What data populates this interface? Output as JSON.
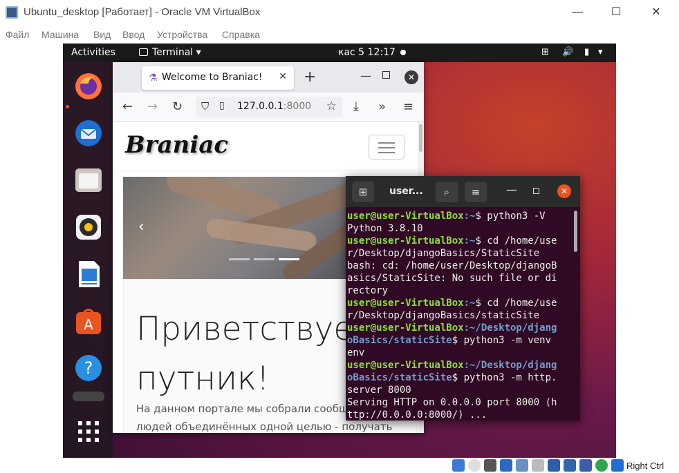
{
  "host": {
    "title": "Ubuntu_desktop [Работает] - Oracle VM VirtualBox",
    "controls": {
      "minimize": "—",
      "maximize": "☐",
      "close": "✕"
    },
    "menu": [
      "Файл",
      "Машина",
      "Вид",
      "Ввод",
      "Устройства",
      "Справка"
    ],
    "host_key": "Right Ctrl"
  },
  "guest": {
    "topbar": {
      "activities": "Activities",
      "app_menu": "Terminal ▾",
      "clock": "кас 5  12:17",
      "tray": {
        "network": "⊞",
        "volume": "🔊",
        "battery": "▮",
        "menu": "▾"
      }
    },
    "dock": {
      "items": [
        "firefox-icon",
        "thunderbird-icon",
        "files-icon",
        "rhythmbox-icon",
        "writer-icon",
        "software-icon",
        "help-icon",
        "show-apps-icon"
      ]
    },
    "firefox": {
      "tab_title": "Welcome to Braniac!",
      "tab_icon": "⚗",
      "url_host": "127.0.0.1",
      "url_port": ":8000",
      "page": {
        "logo": "Braniac",
        "heading_line1": "Приветствуем,",
        "heading_line2": "путник!",
        "text_line1": "На данном портале мы собрали сообщество",
        "text_line2": "людей объединённых одной целью - получать"
      }
    },
    "terminal": {
      "title": "user...",
      "prompt_user": "user@user-VirtualBox",
      "lines": [
        {
          "u": "user@user-VirtualBox",
          "p": ":~",
          "t": "$ python3 -V"
        },
        {
          "u": "",
          "p": "",
          "t": "Python 3.8.10"
        },
        {
          "u": "user@user-VirtualBox",
          "p": ":~",
          "t": "$ cd /home/use"
        },
        {
          "u": "",
          "p": "",
          "t": "r/Desktop/djangoBasics/StaticSite"
        },
        {
          "u": "",
          "p": "",
          "t": "bash: cd: /home/user/Desktop/djangoB"
        },
        {
          "u": "",
          "p": "",
          "t": "asics/StaticSite: No such file or di"
        },
        {
          "u": "",
          "p": "",
          "t": "rectory"
        },
        {
          "u": "user@user-VirtualBox",
          "p": ":~",
          "t": "$ cd /home/use"
        },
        {
          "u": "",
          "p": "",
          "t": "r/Desktop/djangoBasics/staticSite"
        },
        {
          "u": "user@user-VirtualBox",
          "p": ":~/Desktop/djang",
          "t": ""
        },
        {
          "u": "",
          "p": "oBasics/staticSite",
          "t": "$ python3 -m venv"
        },
        {
          "u": "",
          "p": "",
          "t": "env"
        },
        {
          "u": "user@user-VirtualBox",
          "p": ":~/Desktop/djang",
          "t": ""
        },
        {
          "u": "",
          "p": "oBasics/staticSite",
          "t": "$ python3 -m http."
        },
        {
          "u": "",
          "p": "",
          "t": "server 8000"
        },
        {
          "u": "",
          "p": "",
          "t": "Serving HTTP on 0.0.0.0 port 8000 (h"
        },
        {
          "u": "",
          "p": "",
          "t": "ttp://0.0.0.0:8000/) ..."
        }
      ]
    }
  },
  "colors": {
    "ubuntu_orange": "#e95420",
    "terminal_bg": "#300a24",
    "prompt_user": "#8ae234",
    "prompt_path": "#729fcf"
  }
}
